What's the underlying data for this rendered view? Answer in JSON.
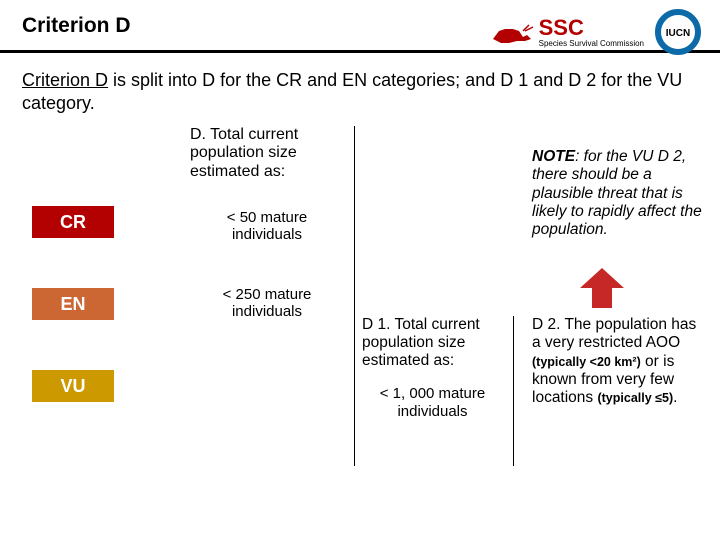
{
  "header": {
    "title": "Criterion D",
    "logos": {
      "ssc_text": "SSC",
      "ssc_sub": "Species Survival Commission",
      "iucn_text": "IUCN"
    }
  },
  "intro": {
    "lead": "Criterion D",
    "rest": " is split into D for the CR and EN categories; and D 1 and D 2 for the VU category."
  },
  "categories": {
    "cr": "CR",
    "en": "EN",
    "vu": "VU"
  },
  "column_d": {
    "heading": "D. Total current population size estimated as:",
    "cr_text": "< 50 mature individuals",
    "en_text": "< 250 mature individuals"
  },
  "column_d1": {
    "heading": "D 1. Total current population size estimated as:",
    "vu_text": "< 1, 000 mature individuals"
  },
  "note": {
    "label": "NOTE",
    "text": ": for the VU D 2, there should be a plausible threat that is likely to rapidly affect the population."
  },
  "column_d2": {
    "lead": "D 2. ",
    "part1": "The population has a very restricted AOO ",
    "small1": "(typically <20 km²)",
    "part2": " or is known from very few locations ",
    "small2": "(typically ≤5)",
    "tail": "."
  }
}
